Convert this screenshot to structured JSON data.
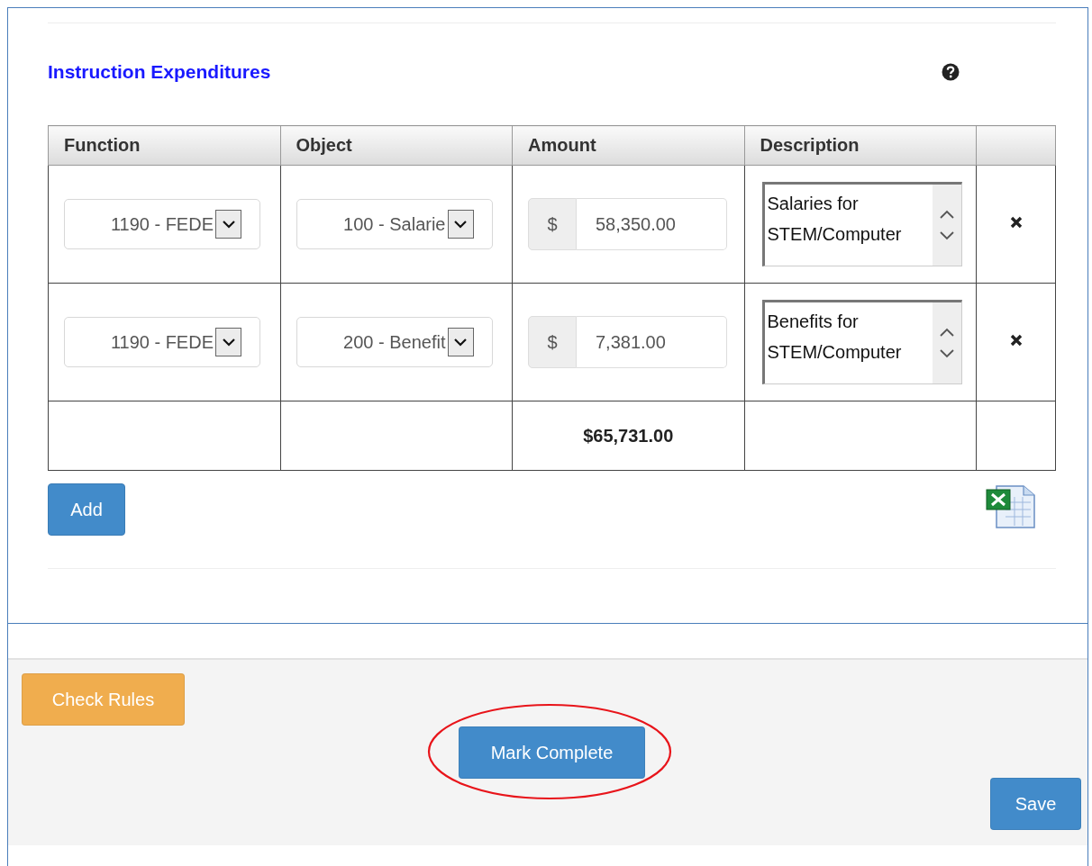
{
  "section": {
    "title": "Instruction Expenditures"
  },
  "table": {
    "columns": [
      "Function",
      "Object",
      "Amount",
      "Description"
    ],
    "rows": [
      {
        "function": "1190 - FEDE",
        "object": "100 - Salarie",
        "currency": "$",
        "amount": "58,350.00",
        "description": "Salaries for STEM/Computer"
      },
      {
        "function": "1190 - FEDE",
        "object": "200 - Benefit",
        "currency": "$",
        "amount": "7,381.00",
        "description": "Benefits for STEM/Computer"
      }
    ],
    "total": "$65,731.00"
  },
  "add_button": "Add",
  "footer": {
    "buttons": [
      {
        "label": "Check Rules",
        "kind": "warning",
        "highlighted": false
      },
      {
        "label": "Mark Complete",
        "kind": "primary",
        "highlighted": true
      },
      {
        "label": "Save",
        "kind": "primary",
        "highlighted": false
      }
    ]
  }
}
